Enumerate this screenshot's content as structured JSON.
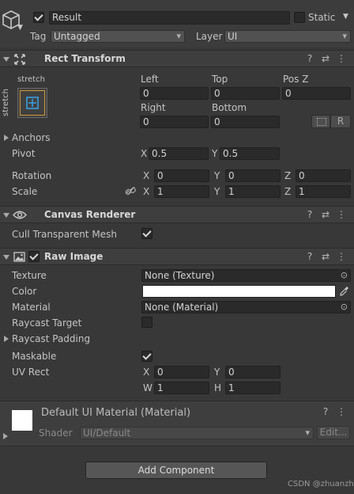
{
  "header": {
    "name": "Result",
    "static_label": "Static",
    "tag_label": "Tag",
    "tag_value": "Untagged",
    "layer_label": "Layer",
    "layer_value": "UI"
  },
  "rect_transform": {
    "title": "Rect Transform",
    "anchor_top_label": "stretch",
    "anchor_side_label": "stretch",
    "left_label": "Left",
    "left_value": "0",
    "top_label": "Top",
    "top_value": "0",
    "posz_label": "Pos Z",
    "posz_value": "0",
    "right_label": "Right",
    "right_value": "0",
    "bottom_label": "Bottom",
    "bottom_value": "0",
    "r_button": "R",
    "anchors_label": "Anchors",
    "pivot_label": "Pivot",
    "pivot": {
      "x_label": "X",
      "x": "0.5",
      "y_label": "Y",
      "y": "0.5"
    },
    "rotation_label": "Rotation",
    "rotation": {
      "x_label": "X",
      "x": "0",
      "y_label": "Y",
      "y": "0",
      "z_label": "Z",
      "z": "0"
    },
    "scale_label": "Scale",
    "scale": {
      "x_label": "X",
      "x": "1",
      "y_label": "Y",
      "y": "1",
      "z_label": "Z",
      "z": "1"
    }
  },
  "canvas_renderer": {
    "title": "Canvas Renderer",
    "cull_label": "Cull Transparent Mesh",
    "cull_checked": true
  },
  "raw_image": {
    "title": "Raw Image",
    "texture_label": "Texture",
    "texture_value": "None (Texture)",
    "color_label": "Color",
    "color_value": "#ffffff",
    "material_label": "Material",
    "material_value": "None (Material)",
    "raycast_target_label": "Raycast Target",
    "raycast_padding_label": "Raycast Padding",
    "maskable_label": "Maskable",
    "uvrect_label": "UV Rect",
    "uv": {
      "x_label": "X",
      "x": "0",
      "y_label": "Y",
      "y": "0",
      "w_label": "W",
      "w": "1",
      "h_label": "H",
      "h": "1"
    }
  },
  "material_preview": {
    "title": "Default UI Material (Material)",
    "shader_label": "Shader",
    "shader_value": "UI/Default",
    "edit_button": "Edit..."
  },
  "footer": {
    "add_component": "Add Component",
    "watermark": "CSDN @zhuanzhuo"
  },
  "icons": {
    "help": "?",
    "presets": "⇄",
    "more": "⋮"
  }
}
